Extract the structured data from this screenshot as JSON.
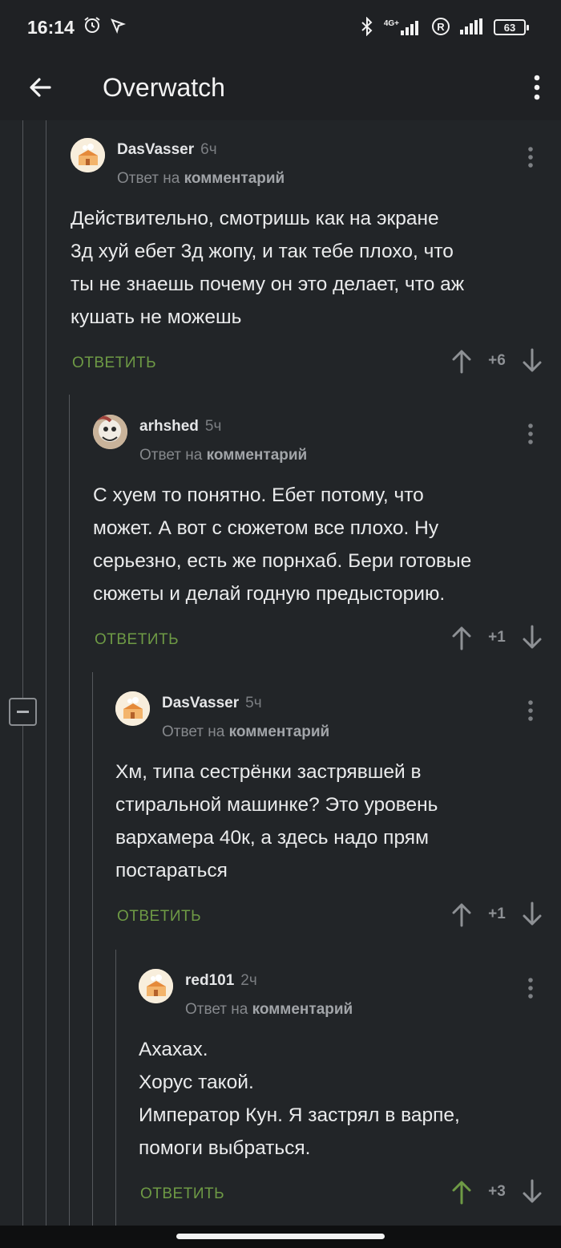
{
  "status_bar": {
    "time": "16:14",
    "network": "4G+",
    "battery": "63"
  },
  "app_bar": {
    "title": "Overwatch"
  },
  "comments": [
    {
      "user": "DasVasser",
      "time": "6ч",
      "reply_prefix": "Ответ на",
      "reply_target": "комментарий",
      "text_lines": [
        "Действительно, смотришь как на экране",
        "3д хуй ебет 3д жопу, и так тебе плохо, что",
        "ты не знаешь почему он это делает, что аж",
        "кушать не можешь"
      ],
      "reply_label": "ОТВЕТИТЬ",
      "score": "+6",
      "upvoted": false
    },
    {
      "user": "arhshed",
      "time": "5ч",
      "reply_prefix": "Ответ на",
      "reply_target": "комментарий",
      "text_lines": [
        "С хуем то понятно. Ебет потому, что",
        "может. А вот с сюжетом все плохо. Ну",
        "серьезно, есть же порнхаб. Бери готовые",
        "сюжеты и делай годную предысторию."
      ],
      "reply_label": "ОТВЕТИТЬ",
      "score": "+1",
      "upvoted": false
    },
    {
      "user": "DasVasser",
      "time": "5ч",
      "reply_prefix": "Ответ на",
      "reply_target": "комментарий",
      "text_lines": [
        "Хм, типа сестрёнки застрявшей в",
        "стиральной машинке? Это уровень",
        "вархамера 40к, а здесь надо прям",
        "постараться"
      ],
      "reply_label": "ОТВЕТИТЬ",
      "score": "+1",
      "upvoted": false
    },
    {
      "user": "red101",
      "time": "2ч",
      "reply_prefix": "Ответ на",
      "reply_target": "комментарий",
      "text_lines": [
        "Ахахах.",
        "Хорус такой.",
        "Император Кун. Я застрял в варпе,",
        "помоги выбраться."
      ],
      "reply_label": "ОТВЕТИТЬ",
      "score": "+3",
      "upvoted": true
    }
  ],
  "colors": {
    "accent_green": "#6e9a45",
    "background": "#222528",
    "upvote_active": "#6e9a45"
  }
}
